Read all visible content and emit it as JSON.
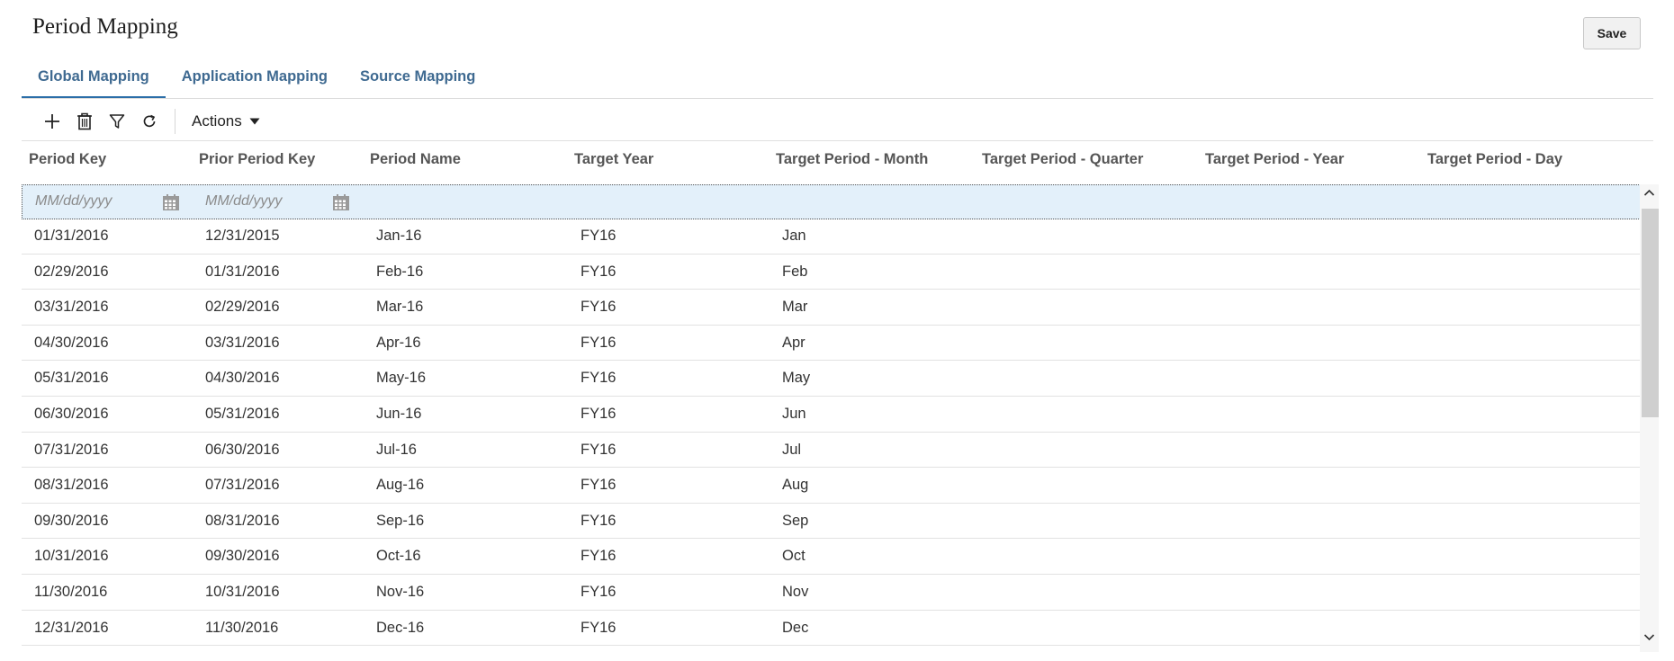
{
  "page": {
    "title": "Period Mapping"
  },
  "save_label": "Save",
  "tabs": [
    {
      "label": "Global Mapping",
      "active": true
    },
    {
      "label": "Application Mapping",
      "active": false
    },
    {
      "label": "Source Mapping",
      "active": false
    }
  ],
  "toolbar": {
    "icons": [
      "add-icon",
      "delete-icon",
      "filter-icon",
      "refresh-icon"
    ],
    "actions_label": "Actions"
  },
  "columns": [
    "Period Key",
    "Prior Period Key",
    "Period Name",
    "Target Year",
    "Target Period - Month",
    "Target Period - Quarter",
    "Target Period - Year",
    "Target Period - Day"
  ],
  "filter": {
    "period_key_placeholder": "MM/dd/yyyy",
    "prior_period_key_placeholder": "MM/dd/yyyy"
  },
  "rows": [
    [
      "01/31/2016",
      "12/31/2015",
      "Jan-16",
      "FY16",
      "Jan",
      "",
      "",
      ""
    ],
    [
      "02/29/2016",
      "01/31/2016",
      "Feb-16",
      "FY16",
      "Feb",
      "",
      "",
      ""
    ],
    [
      "03/31/2016",
      "02/29/2016",
      "Mar-16",
      "FY16",
      "Mar",
      "",
      "",
      ""
    ],
    [
      "04/30/2016",
      "03/31/2016",
      "Apr-16",
      "FY16",
      "Apr",
      "",
      "",
      ""
    ],
    [
      "05/31/2016",
      "04/30/2016",
      "May-16",
      "FY16",
      "May",
      "",
      "",
      ""
    ],
    [
      "06/30/2016",
      "05/31/2016",
      "Jun-16",
      "FY16",
      "Jun",
      "",
      "",
      ""
    ],
    [
      "07/31/2016",
      "06/30/2016",
      "Jul-16",
      "FY16",
      "Jul",
      "",
      "",
      ""
    ],
    [
      "08/31/2016",
      "07/31/2016",
      "Aug-16",
      "FY16",
      "Aug",
      "",
      "",
      ""
    ],
    [
      "09/30/2016",
      "08/31/2016",
      "Sep-16",
      "FY16",
      "Sep",
      "",
      "",
      ""
    ],
    [
      "10/31/2016",
      "09/30/2016",
      "Oct-16",
      "FY16",
      "Oct",
      "",
      "",
      ""
    ],
    [
      "11/30/2016",
      "10/31/2016",
      "Nov-16",
      "FY16",
      "Nov",
      "",
      "",
      ""
    ],
    [
      "12/31/2016",
      "11/30/2016",
      "Dec-16",
      "FY16",
      "Dec",
      "",
      "",
      ""
    ]
  ],
  "colors": {
    "tab_text": "#3f6a91",
    "tab_active_underline": "#2b6ea8",
    "filter_row_bg": "#e3f0fa"
  }
}
